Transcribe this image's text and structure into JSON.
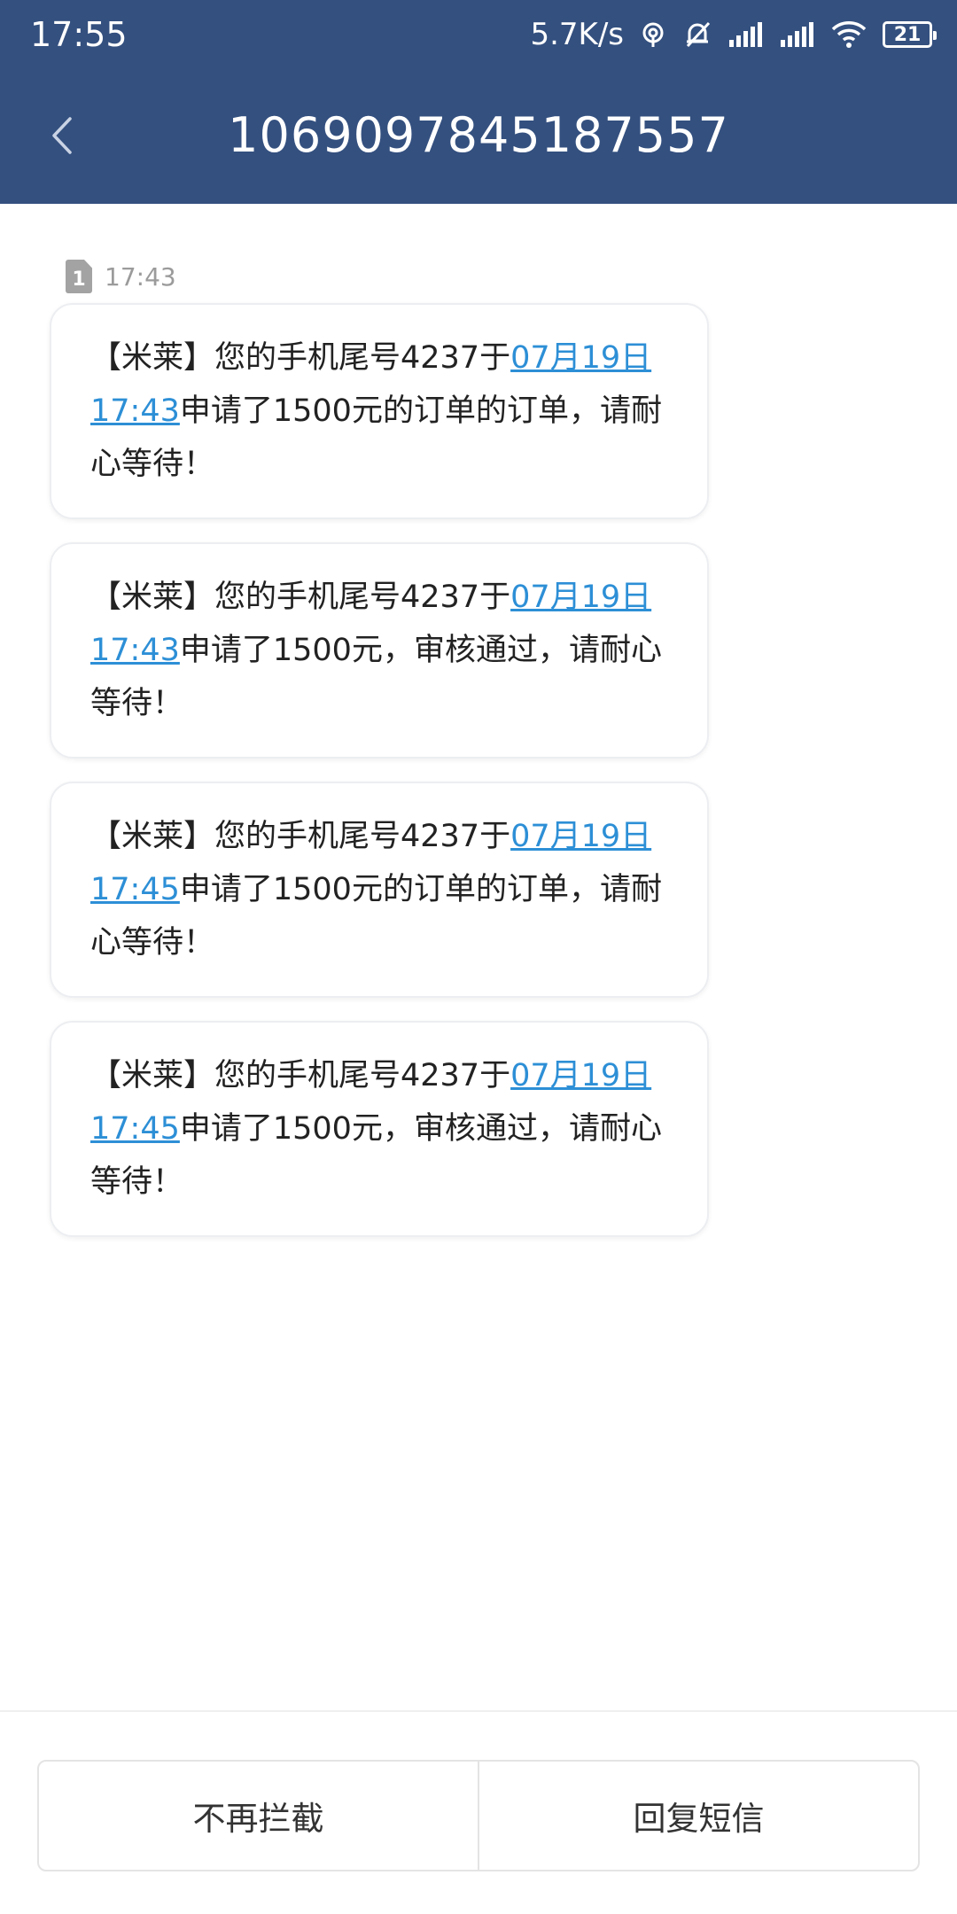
{
  "status_bar": {
    "time": "17:55",
    "net_speed": "5.7K/s",
    "battery": "21",
    "icons": [
      "hotspot-icon",
      "silent-alarm-icon",
      "signal-icon",
      "signal-icon",
      "wifi-icon",
      "battery-icon"
    ]
  },
  "header": {
    "back_icon": "chevron-left-icon",
    "title": "1069097845187557"
  },
  "sim": {
    "badge": "1",
    "time": "17:43"
  },
  "messages": [
    {
      "pre": "【米莱】您的手机尾号4237于",
      "link1": "07月19日",
      "link2": "17:43",
      "post": "申请了1500元的订单的订单，请耐心等待！"
    },
    {
      "pre": "【米莱】您的手机尾号4237于",
      "link1": "07月19日",
      "link2": "17:43",
      "post": "申请了1500元，审核通过，请耐心等待！"
    },
    {
      "pre": "【米莱】您的手机尾号4237于",
      "link1": "07月19日",
      "link2": "17:45",
      "post": "申请了1500元的订单的订单，请耐心等待！"
    },
    {
      "pre": "【米莱】您的手机尾号4237于",
      "link1": "07月19日",
      "link2": "17:45",
      "post": "申请了1500元，审核通过，请耐心等待！"
    }
  ],
  "actions": {
    "unblock": "不再拦截",
    "reply": "回复短信"
  },
  "colors": {
    "header_bg": "#34507f",
    "link": "#2d8fd6",
    "text": "#222222"
  }
}
